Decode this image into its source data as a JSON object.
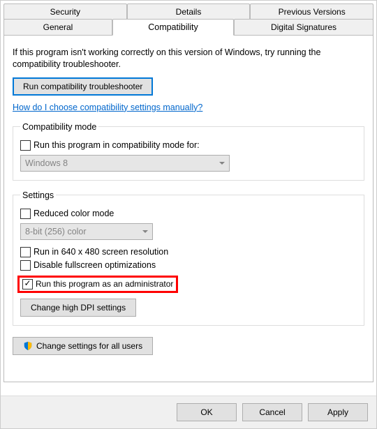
{
  "tabs": {
    "security": "Security",
    "details": "Details",
    "previous_versions": "Previous Versions",
    "general": "General",
    "compatibility": "Compatibility",
    "digital_signatures": "Digital Signatures"
  },
  "intro": "If this program isn't working correctly on this version of Windows, try running the compatibility troubleshooter.",
  "troubleshooter_btn": "Run compatibility troubleshooter",
  "manual_link": "How do I choose compatibility settings manually?",
  "compat_mode": {
    "legend": "Compatibility mode",
    "checkbox_label": "Run this program in compatibility mode for:",
    "selected": "Windows 8"
  },
  "settings": {
    "legend": "Settings",
    "reduced_color": "Reduced color mode",
    "color_selected": "8-bit (256) color",
    "res_640": "Run in 640 x 480 screen resolution",
    "disable_fullscreen": "Disable fullscreen optimizations",
    "run_admin": "Run this program as an administrator",
    "dpi_btn": "Change high DPI settings"
  },
  "all_users_btn": "Change settings for all users",
  "footer": {
    "ok": "OK",
    "cancel": "Cancel",
    "apply": "Apply"
  }
}
